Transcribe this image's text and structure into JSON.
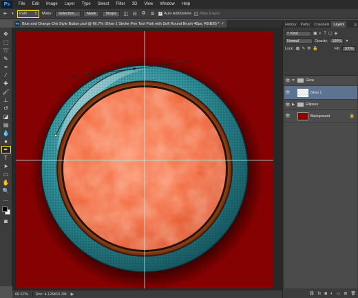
{
  "app": {
    "logo": "Ps"
  },
  "menu": [
    "File",
    "Edit",
    "Image",
    "Layer",
    "Type",
    "Select",
    "Filter",
    "3D",
    "View",
    "Window",
    "Help"
  ],
  "options": {
    "mode_value": "Path",
    "make_label": "Make:",
    "selection_btn": "Selection...",
    "mask_btn": "Mask",
    "shape_btn": "Shape",
    "auto_add_delete": "Auto Add/Delete",
    "align_edges": "Align Edges"
  },
  "document": {
    "tab_title": "Blue and Orange Orb Style Button.psd @ 66.7% (Glow 1  Stroke Pen Tool Path with Soft Round Brush 40px, RGB/8) *",
    "tab_icon": "Ps"
  },
  "status": {
    "zoom": "66.67%",
    "doc": "Doc: 4.12M/16.2M"
  },
  "panel": {
    "tabs": [
      "History",
      "Paths",
      "Channels",
      "Layers"
    ],
    "active_tab": "Layers",
    "kind_label": "Kind",
    "blend_mode": "Normal",
    "opacity_label": "Opacity:",
    "opacity_value": "100%",
    "lock_label": "Lock:",
    "fill_label": "Fill:",
    "fill_value": "100%",
    "layers": [
      {
        "name": "Glow",
        "type": "group",
        "expanded": true
      },
      {
        "name": "Glow 1",
        "type": "layer",
        "selected": true
      },
      {
        "name": "Ellipses",
        "type": "group",
        "expanded": false
      },
      {
        "name": "Background",
        "type": "layer"
      }
    ]
  },
  "colors": {
    "canvas_bg": "#860101",
    "orb_fill": "#f26a3f",
    "teal_ring": "#2e8f98",
    "bronze_ring": "#b85a1e",
    "highlight": "#ffe600"
  }
}
